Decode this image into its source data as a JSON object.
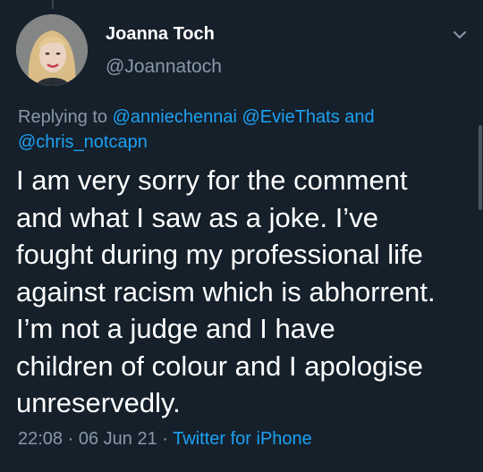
{
  "author": {
    "name": "Joanna Toch",
    "handle": "@Joannatoch"
  },
  "reply": {
    "prefix": "Replying to",
    "mention_1": "@anniechennai",
    "mention_2": "@EvieThats",
    "conjunction": "and",
    "mention_3": "@chris_notcapn"
  },
  "tweet": {
    "lines": [
      "I am very sorry for the comment",
      "and what I saw as a joke. I’ve",
      "fought during my professional life",
      "against racism which is abhorrent.",
      "I’m not a judge and I have",
      "children of colour and I apologise",
      "unreservedly."
    ]
  },
  "meta": {
    "time": "22:08",
    "separator": "·",
    "date": "06 Jun 21",
    "source": "Twitter for iPhone"
  },
  "colors": {
    "background": "#15202b",
    "text": "#ffffff",
    "secondary": "#8899a6",
    "link": "#1da1f2"
  },
  "icons": {
    "more": "chevron-down-icon"
  }
}
